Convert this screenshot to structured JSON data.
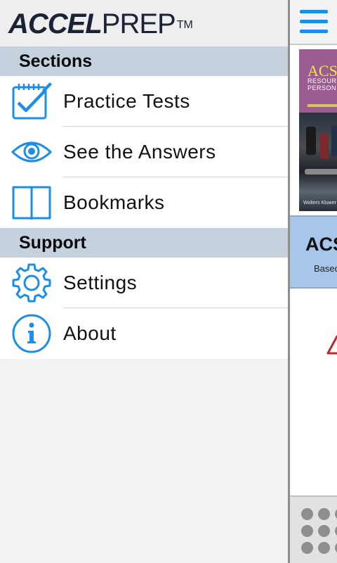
{
  "app": {
    "logo_bold": "ACCEL",
    "logo_light": "PREP",
    "logo_tm": "TM"
  },
  "sections": [
    {
      "title": "Sections",
      "items": [
        {
          "label": "Practice Tests",
          "icon": "checklist-icon"
        },
        {
          "label": "See the Answers",
          "icon": "eye-icon"
        },
        {
          "label": "Bookmarks",
          "icon": "book-icon"
        }
      ]
    },
    {
      "title": "Support",
      "items": [
        {
          "label": "Settings",
          "icon": "gear-icon"
        },
        {
          "label": "About",
          "icon": "info-icon"
        }
      ]
    }
  ],
  "main": {
    "book_title": "ACS",
    "book_sub1": "RESOUR",
    "book_sub2": "PERSON",
    "book_publisher": "Wolters Kluwer",
    "card_title": "ACS",
    "card_subtitle": "Based"
  },
  "colors": {
    "accent": "#1d8ee8",
    "section_header": "#c5d1dd",
    "card": "#a7c6ea",
    "warning": "#c0272d"
  }
}
